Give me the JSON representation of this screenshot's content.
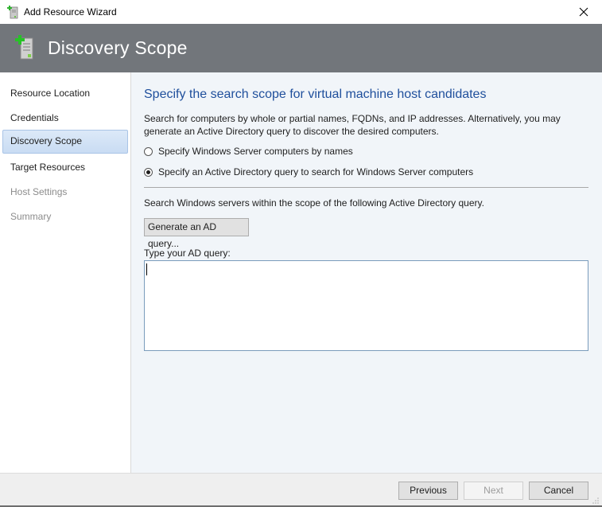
{
  "window": {
    "title": "Add Resource Wizard",
    "app_icon": "server-add-icon",
    "close_icon": "close-icon"
  },
  "header": {
    "title": "Discovery Scope",
    "icon": "server-add-icon",
    "background": "#72767b"
  },
  "sidebar": {
    "items": [
      {
        "label": "Resource Location",
        "state": "normal"
      },
      {
        "label": "Credentials",
        "state": "normal"
      },
      {
        "label": "Discovery Scope",
        "state": "active"
      },
      {
        "label": "Target Resources",
        "state": "normal"
      },
      {
        "label": "Host Settings",
        "state": "disabled"
      },
      {
        "label": "Summary",
        "state": "disabled"
      }
    ]
  },
  "main": {
    "title": "Specify the search scope for virtual machine host candidates",
    "description": "Search for computers by whole or partial names, FQDNs, and IP addresses. Alternatively, you may generate an Active Directory query to discover the desired computers.",
    "options": [
      {
        "label": "Specify Windows Server computers by names",
        "checked": false
      },
      {
        "label": "Specify an Active Directory query to search for Windows Server computers",
        "checked": true
      }
    ],
    "scope_text": "Search Windows servers within the scope of the following Active Directory query.",
    "generate_button": "Generate an AD query...",
    "query_label": "Type your AD query:",
    "query_value": ""
  },
  "footer": {
    "previous": "Previous",
    "next": "Next",
    "next_enabled": false,
    "cancel": "Cancel"
  },
  "colors": {
    "accent_title": "#1f4f9c",
    "active_nav": "#c9dcf3",
    "content_bg": "#f1f5f9"
  }
}
